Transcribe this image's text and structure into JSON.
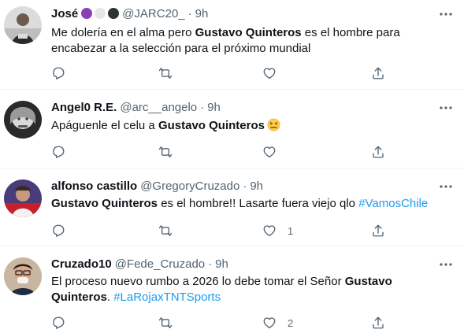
{
  "tweets": [
    {
      "name": "José",
      "badges": [
        "#8a3fb5",
        "#e6e6e6",
        "#2f3336"
      ],
      "handle": "@JARC20_",
      "separator": "·",
      "time": "9h",
      "text": {
        "pre": "Me dolería en el alma pero ",
        "bold": "Gustavo Quinteros",
        "post": " es el hombre para encabezar a la selección para el próximo mundial"
      },
      "likes": ""
    },
    {
      "name": "Angel0 R.E.",
      "handle": "@arc__angelo",
      "separator": "·",
      "time": "9h",
      "text": {
        "pre": "Apáguenle el celu a ",
        "bold": "Gustavo Quinteros"
      },
      "emoji": "confounded-face",
      "likes": ""
    },
    {
      "name": "alfonso castillo",
      "handle": "@GregoryCruzado",
      "separator": "·",
      "time": "9h",
      "text": {
        "bold": "Gustavo Quinteros",
        "post": " es el hombre!! Lasarte fuera viejo qlo ",
        "tag": "#VamosChile"
      },
      "likes": "1"
    },
    {
      "name": "Cruzado10",
      "handle": "@Fede_Cruzado",
      "separator": "·",
      "time": "9h",
      "text": {
        "pre": "El proceso nuevo rumbo a 2026 lo debe tomar el Señor ",
        "bold": "Gustavo Quinteros",
        "post": ". ",
        "tag": "#LaRojaxTNTSports"
      },
      "likes": "2"
    }
  ],
  "icons": {
    "more": "more-dots-icon",
    "reply": "reply-icon",
    "retweet": "retweet-icon",
    "like": "heart-icon",
    "share": "share-icon"
  },
  "colors": {
    "text": "#0f1419",
    "secondary": "#536471",
    "link": "#1d9bf0",
    "divider": "#eff3f4"
  }
}
